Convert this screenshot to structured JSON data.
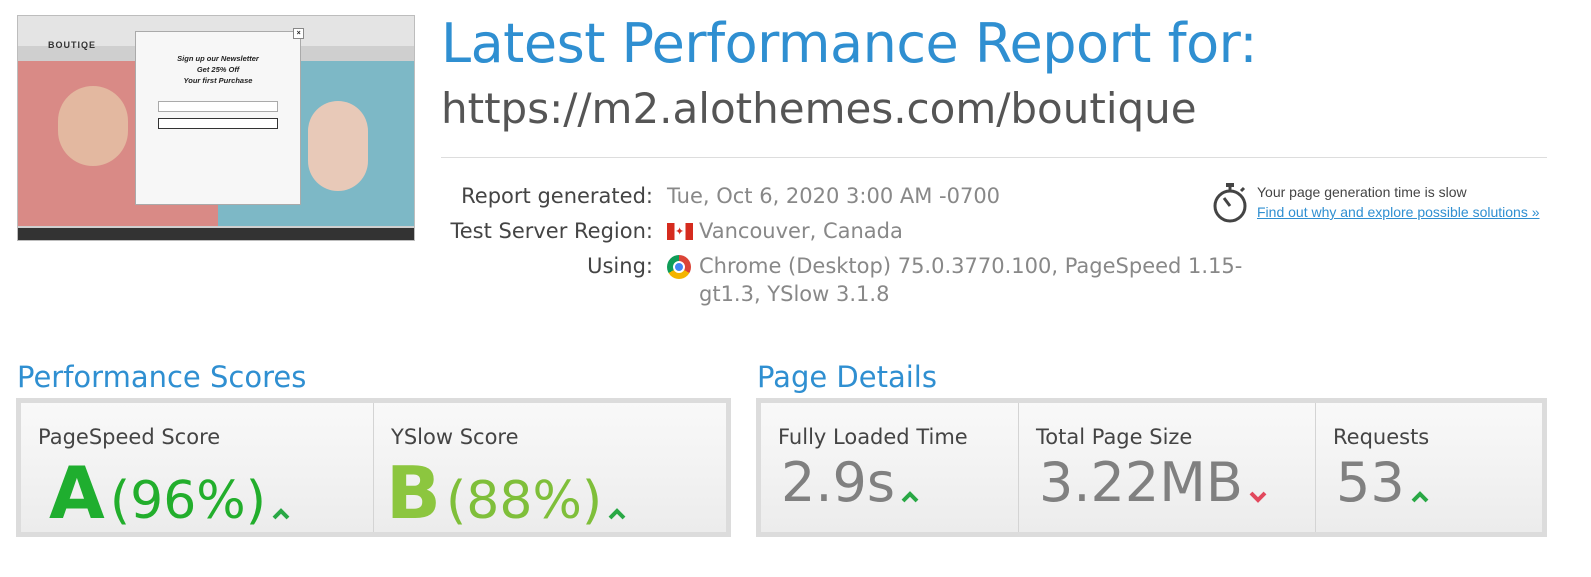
{
  "thumbnail": {
    "brand": "BOUTIQE",
    "popup_line1": "Sign up our Newsletter",
    "popup_line2": "Get 25% Off",
    "popup_line3": "Your first Purchase"
  },
  "header": {
    "title": "Latest Performance Report for:",
    "url": "https://m2.alothemes.com/boutique"
  },
  "report": {
    "generated_label": "Report generated:",
    "generated_value": "Tue, Oct 6, 2020 3:00 AM -0700",
    "region_label": "Test Server Region:",
    "region_value": "Vancouver, Canada",
    "using_label": "Using:",
    "using_value_line1": "Chrome (Desktop) 75.0.3770.100, PageSpeed 1.15-",
    "using_value_line2": "gt1.3, YSlow 3.1.8"
  },
  "note": {
    "text": "Your page generation time is slow",
    "link": "Find out why and explore possible solutions »"
  },
  "performance": {
    "title": "Performance Scores",
    "pagespeed_label": "PageSpeed Score",
    "pagespeed_grade": "A",
    "pagespeed_pct": "(96%)",
    "yslow_label": "YSlow Score",
    "yslow_grade": "B",
    "yslow_pct": "(88%)"
  },
  "details": {
    "title": "Page Details",
    "loaded_label": "Fully Loaded Time",
    "loaded_value": "2.9s",
    "size_label": "Total Page Size",
    "size_value": "3.22MB",
    "requests_label": "Requests",
    "requests_value": "53"
  },
  "colors": {
    "accent": "#2f8fd1",
    "grade_a": "#1fae2f",
    "grade_b": "#8cc63f",
    "up": "#29a845",
    "down": "#e2485d"
  }
}
